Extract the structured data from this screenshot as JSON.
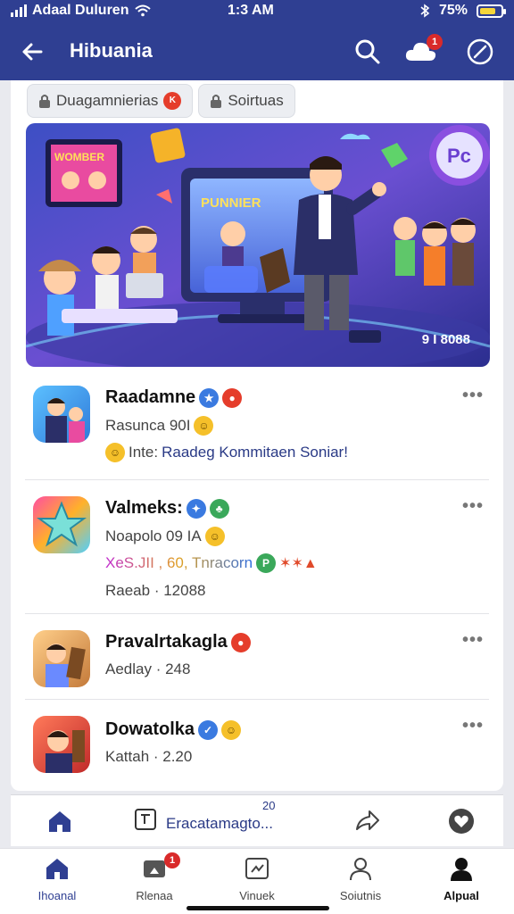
{
  "status_bar": {
    "carrier": "Adaal Duluren",
    "time": "1:3 AM",
    "battery": "75%",
    "battery_level": 0.75
  },
  "header": {
    "title": "Hibuania",
    "notification_count": "1"
  },
  "chips": [
    {
      "label": "Duagamnierias",
      "badge": "K"
    },
    {
      "label": "Soirtuas"
    }
  ],
  "hero": {
    "screen_text": "PUNNIER",
    "tv_text": "WOMBER",
    "bubble_text": "Pc",
    "counter": "9 I 8088"
  },
  "posts": [
    {
      "name": "Raadamne",
      "line1": "Rasunca 90I",
      "line2_prefix": "Inte:",
      "line2_link": "Raadeg Kommitaen Soniar!"
    },
    {
      "name": "Valmeks:",
      "line1": "Noapolo 09 IA",
      "line2": "XeS.JII , 60, Tnracorn",
      "line3": "Raeab · 12088"
    },
    {
      "name": "Pravalrtakagla",
      "line1": "Aedlay · 248"
    },
    {
      "name": "Dowatolka",
      "line1": "Kattah · 2.20"
    }
  ],
  "more_label": "•••",
  "actions": {
    "middle_label": "Eracatamagto...",
    "middle_badge": "20"
  },
  "tabs": [
    {
      "label": "Ihoanal"
    },
    {
      "label": "Rlenaa",
      "badge": "1"
    },
    {
      "label": "Vinuek"
    },
    {
      "label": "Soiutnis"
    },
    {
      "label": "Alpual"
    }
  ],
  "colors": {
    "header": "#2f3f92",
    "badge": "#d92a2a",
    "link": "#2a3a86"
  }
}
